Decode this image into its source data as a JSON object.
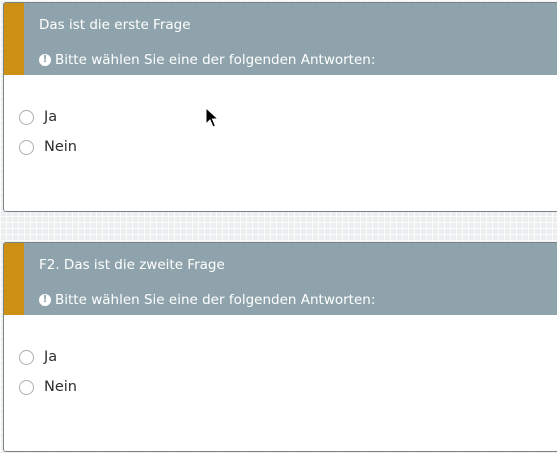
{
  "questions": [
    {
      "title": "Das ist die erste Frage",
      "hint": "Bitte wählen Sie eine der folgenden Antworten:",
      "options": [
        "Ja",
        "Nein"
      ]
    },
    {
      "title": "F2. Das ist die zweite Frage",
      "hint": "Bitte wählen Sie eine der folgenden Antworten:",
      "options": [
        "Ja",
        "Nein"
      ]
    }
  ],
  "icons": {
    "hint": "exclamation-circle-icon",
    "hint_glyph": "!",
    "cursor": "mouse-pointer-icon"
  },
  "colors": {
    "header_background": "#8fa3ac",
    "accent": "#cc9014",
    "header_text": "#ffffff",
    "option_text": "#2f2f2f"
  }
}
